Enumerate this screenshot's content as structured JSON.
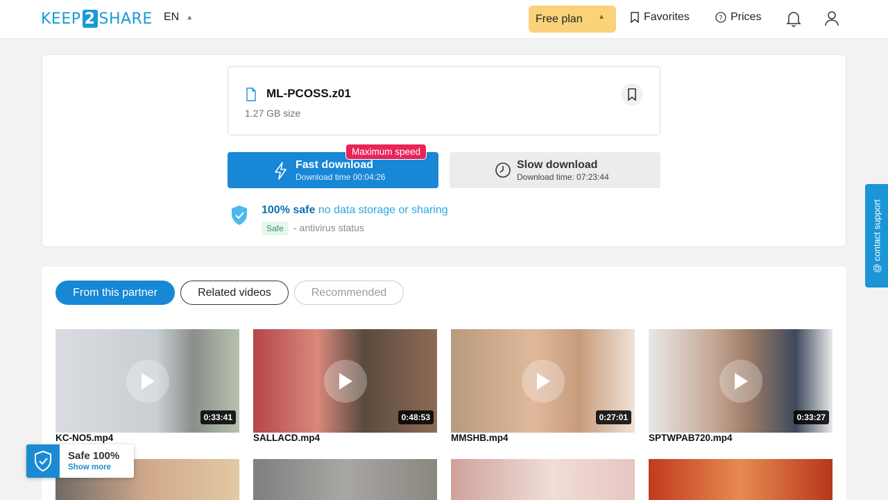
{
  "header": {
    "logo": {
      "left": "KEEP",
      "mid": "2",
      "right": "SHARE"
    },
    "language": "EN",
    "plan_label": "Free plan",
    "favorites_label": "Favorites",
    "prices_label": "Prices"
  },
  "file": {
    "name": "ML-PCOSS.z01",
    "size": "1.27 GB size"
  },
  "downloads": {
    "fast": {
      "title": "Fast download",
      "subtitle": "Download time 00:04:26",
      "badge": "Maximum speed"
    },
    "slow": {
      "title": "Slow download",
      "subtitle": "Download time: 07:23:44"
    }
  },
  "safety": {
    "bold": "100% safe",
    "text": "no data storage or sharing",
    "tag": "Safe",
    "antivirus": "- antivirus status"
  },
  "tabs": [
    {
      "label": "From this partner"
    },
    {
      "label": "Related videos"
    },
    {
      "label": "Recommended"
    }
  ],
  "videos": [
    {
      "name": "KC-NO5.mp4",
      "duration": "0:33:41"
    },
    {
      "name": "SALLACD.mp4",
      "duration": "0:48:53"
    },
    {
      "name": "MMSHB.mp4",
      "duration": "0:27:01"
    },
    {
      "name": "SPTWPAB720.mp4",
      "duration": "0:33:27"
    }
  ],
  "support_label": "@ contact support",
  "safe_badge": {
    "title": "Safe 100%",
    "link": "Show more"
  },
  "colors": {
    "accent": "#1787d6",
    "plan": "#fad27a",
    "badge": "#e8245a"
  }
}
